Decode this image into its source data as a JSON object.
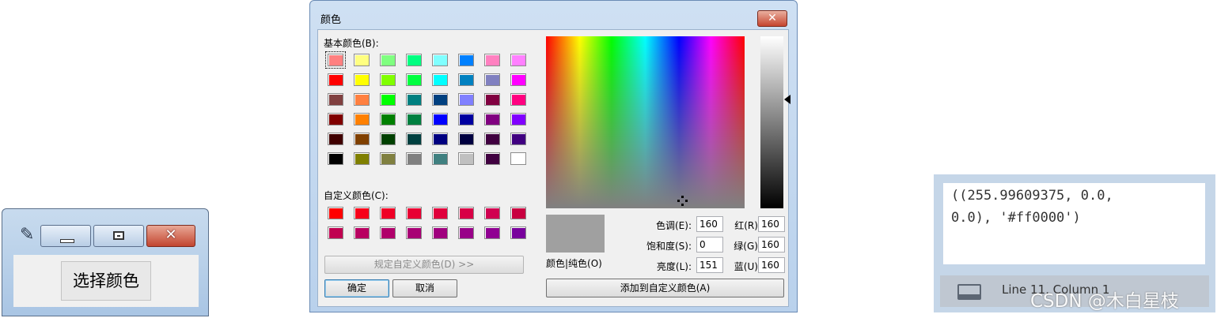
{
  "tk_window": {
    "button_label": "选择颜色"
  },
  "dialog": {
    "title": "颜色",
    "basic_colors_label": "基本颜色(B):",
    "basic_colors": [
      "#ff8080",
      "#ffff80",
      "#80ff80",
      "#00ff80",
      "#80ffff",
      "#0080ff",
      "#ff80c0",
      "#ff80ff",
      "#ff0000",
      "#ffff00",
      "#80ff00",
      "#00ff40",
      "#00ffff",
      "#0080c0",
      "#8080c0",
      "#ff00ff",
      "#804040",
      "#ff8040",
      "#00ff00",
      "#008080",
      "#004080",
      "#8080ff",
      "#800040",
      "#ff0080",
      "#800000",
      "#ff8000",
      "#008000",
      "#008040",
      "#0000ff",
      "#0000a0",
      "#800080",
      "#8000ff",
      "#400000",
      "#804000",
      "#004000",
      "#004040",
      "#000080",
      "#000040",
      "#400040",
      "#400080",
      "#000000",
      "#808000",
      "#808040",
      "#808080",
      "#408080",
      "#c0c0c0",
      "#400040",
      "#ffffff"
    ],
    "custom_colors_label": "自定义颜色(C):",
    "custom_colors": [
      "#ff0000",
      "#f7001a",
      "#ef0026",
      "#e80033",
      "#e0003c",
      "#d80046",
      "#d00050",
      "#c80040",
      "#c00050",
      "#b80060",
      "#b0006a",
      "#a80074",
      "#a0007e",
      "#980088",
      "#900092",
      "#78009c"
    ],
    "define_custom_button": "规定自定义颜色(D) >>",
    "ok_button": "确定",
    "cancel_button": "取消",
    "preview_label": "颜色|纯色(O)",
    "preview_color": "#a0a0a0",
    "hue_label": "色调(E):",
    "hue_value": "160",
    "sat_label": "饱和度(S):",
    "sat_value": "0",
    "lum_label": "亮度(L):",
    "lum_value": "151",
    "red_label": "红(R):",
    "red_value": "160",
    "green_label": "绿(G):",
    "green_value": "160",
    "blue_label": "蓝(U):",
    "blue_value": "160",
    "add_custom_button": "添加到自定义颜色(A)"
  },
  "output": {
    "code_text": "((255.99609375, 0.0,\n0.0), '#ff0000')",
    "status_text": "Line 11, Column 1",
    "terminal_icon": "terminal-icon"
  },
  "watermark": "CSDN @木白星枝"
}
